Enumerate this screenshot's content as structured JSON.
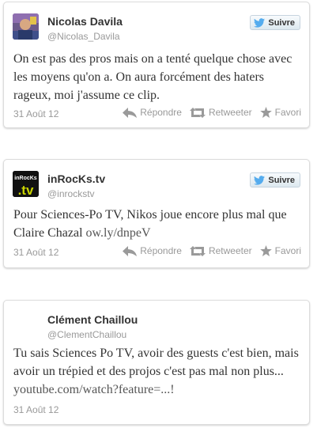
{
  "tweets": [
    {
      "name": "Nicolas Davila",
      "handle": "@Nicolas_Davila",
      "follow_label": "Suivre",
      "text": "On est pas des pros mais on a tenté quelque chose avec les moyens qu'on a. On aura forcément des haters rageux, moi j'assume ce clip.",
      "link": "",
      "date": "31 Août 12",
      "reply_label": "Répondre",
      "retweet_label": "Retweeter",
      "favorite_label": "Favori"
    },
    {
      "name": "inRocKs.tv",
      "handle": "@inrockstv",
      "follow_label": "Suivre",
      "avatar_text_top": "inRocKs",
      "avatar_text_bottom": ".tv",
      "text": "Pour Sciences-Po TV, Nikos joue encore plus mal que Claire Chazal ",
      "link": "ow.ly/dnpeV",
      "date": "31 Août 12",
      "reply_label": "Répondre",
      "retweet_label": "Retweeter",
      "favorite_label": "Favori"
    },
    {
      "name": "Clément Chaillou",
      "handle": "@ClementChaillou",
      "text": "Tu sais Sciences Po TV, avoir des guests c'est bien, mais avoir un trépied et des projos c'est pas mal non plus... ",
      "link": "youtube.com/watch?feature=...!",
      "date": "31 Août 12"
    }
  ],
  "colors": {
    "twitter_bird": "#55acee",
    "name_text": "#333333",
    "meta_text": "#999999"
  },
  "icons": [
    "twitter-bird-icon",
    "reply-icon",
    "retweet-icon",
    "star-icon"
  ]
}
